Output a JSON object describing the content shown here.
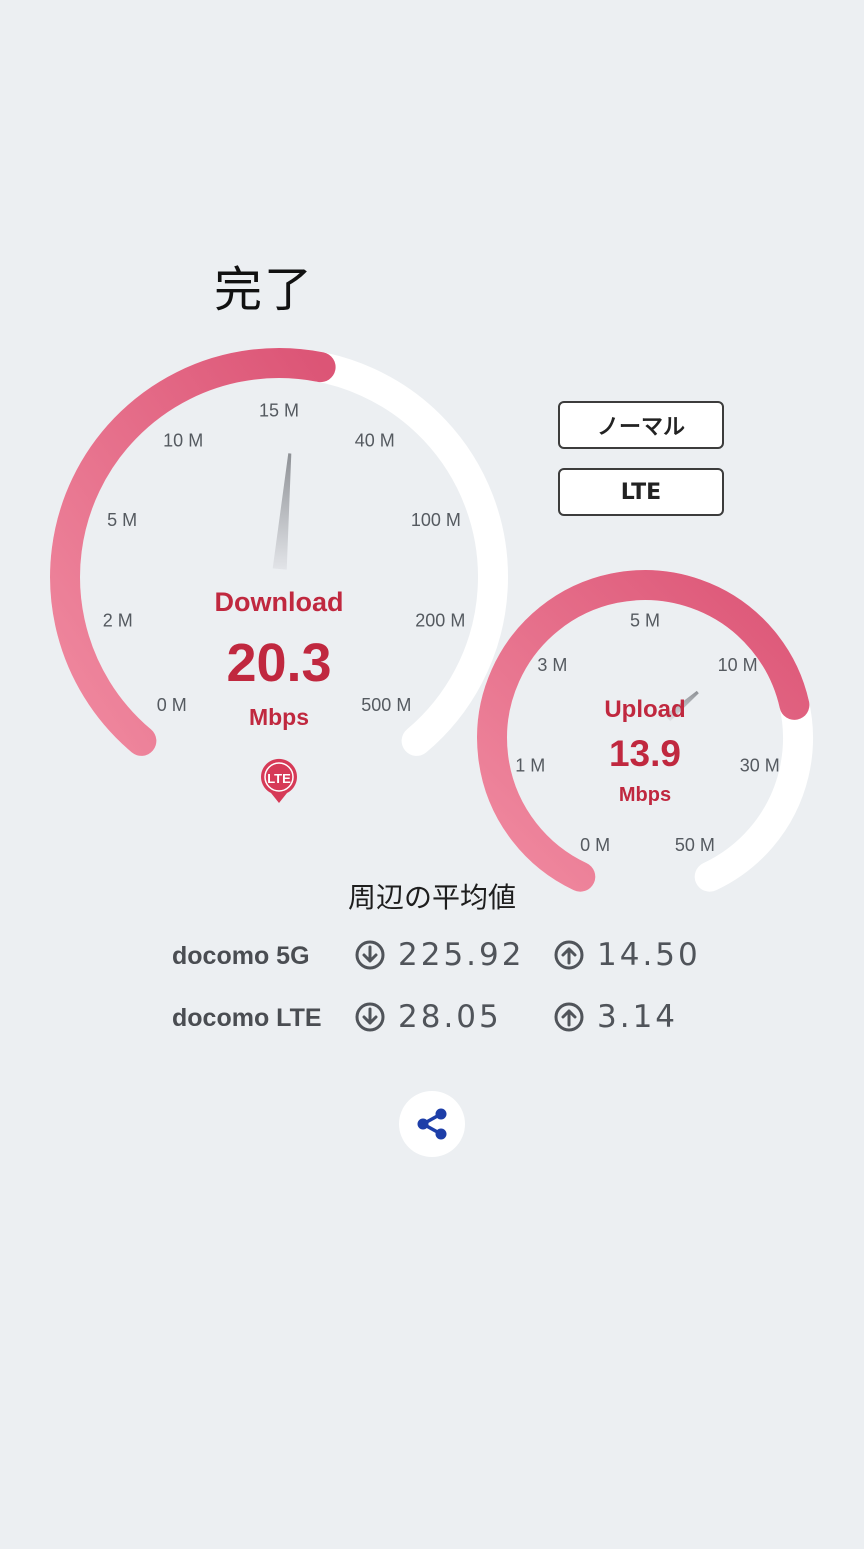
{
  "status_title": "完了",
  "download": {
    "label": "Download",
    "value": "20.3",
    "unit": "Mbps",
    "ticks": [
      "0 M",
      "2 M",
      "5 M",
      "10 M",
      "15 M",
      "40 M",
      "100 M",
      "200 M",
      "500 M"
    ],
    "progress": 0.54,
    "needle_mbps": 20.3,
    "badge": "LTE"
  },
  "upload": {
    "label": "Upload",
    "value": "13.9",
    "unit": "Mbps",
    "ticks": [
      "0 M",
      "1 M",
      "3 M",
      "5 M",
      "10 M",
      "30 M",
      "50 M"
    ],
    "progress": 0.75,
    "needle_mbps": 13.9
  },
  "mode_buttons": [
    {
      "label": "ノーマル"
    },
    {
      "label": "LTE"
    }
  ],
  "averages": {
    "title": "周辺の平均値",
    "rows": [
      {
        "carrier": "docomo  5G",
        "download": "225.92",
        "upload": "14.50"
      },
      {
        "carrier": "docomo LTE",
        "download": "28.05",
        "upload": "3.14"
      }
    ]
  },
  "icons": {
    "download": "arrow-down-circle-icon",
    "upload": "arrow-up-circle-icon",
    "share": "share-icon",
    "badge": "lte-pin-icon"
  },
  "colors": {
    "accent": "#c0283f",
    "arc_start": "#f08aa0",
    "arc_end": "#dc5576",
    "track": "#ffffff",
    "share_icon": "#1d3ea8"
  }
}
